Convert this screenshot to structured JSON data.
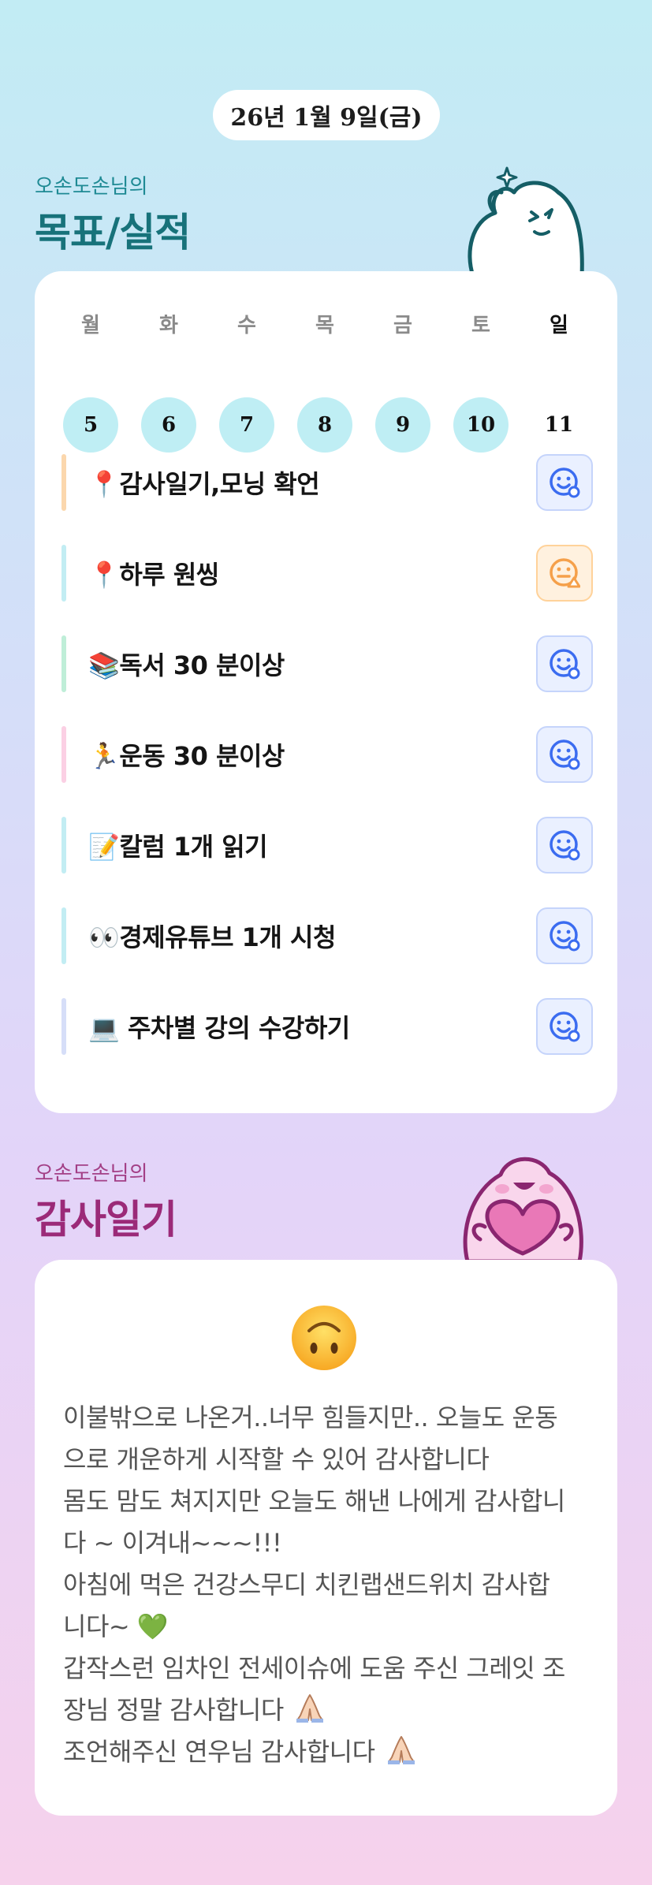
{
  "header": {
    "date": "26년 1월 9일(금)"
  },
  "goal_section": {
    "subtitle": "오손도손님의",
    "title": "목표/실적"
  },
  "week": {
    "days": [
      "월",
      "화",
      "수",
      "목",
      "금",
      "토",
      "일"
    ],
    "dates": [
      "5",
      "6",
      "7",
      "8",
      "9",
      "10",
      "11"
    ],
    "done": [
      true,
      true,
      true,
      true,
      true,
      true,
      false
    ]
  },
  "goals": [
    {
      "label": "📍감사일기,모닝 확언",
      "bar_color": "#fbd7ad",
      "status": "smile",
      "status_icon": "smile-icon"
    },
    {
      "label": "📍하루 원씽",
      "bar_color": "#c2edf3",
      "status": "meh",
      "status_icon": "meh-warning-icon"
    },
    {
      "label": "📚독서 30 분이상",
      "bar_color": "#bfeed8",
      "status": "smile",
      "status_icon": "smile-icon"
    },
    {
      "label": "🏃운동 30 분이상",
      "bar_color": "#fbd0e4",
      "status": "smile",
      "status_icon": "smile-icon"
    },
    {
      "label": "📝칼럼 1개 읽기",
      "bar_color": "#c2edf3",
      "status": "smile",
      "status_icon": "smile-icon"
    },
    {
      "label": "👀경제유튜브 1개 시청",
      "bar_color": "#c2edf3",
      "status": "smile",
      "status_icon": "smile-icon"
    },
    {
      "label": "💻 주차별 강의 수강하기",
      "bar_color": "#d6def8",
      "status": "smile",
      "status_icon": "smile-icon"
    }
  ],
  "diary_section": {
    "subtitle": "오손도손님의",
    "title": "감사일기"
  },
  "diary": {
    "mood_icon": "upside-down-face-icon",
    "lines": [
      "이불밖으로 나온거..너무 힘들지만.. 오늘도 운동",
      "으로 개운하게 시작할 수 있어 감사합니다",
      "몸도 맘도 쳐지지만 오늘도 해낸 나에게 감사합니",
      "다 ~ 이겨내~~~!!!",
      "아침에 먹은 건강스무디 치킨랩샌드위치 감사합",
      "니다~ 💚",
      "갑작스런 임차인 전세이슈에 도움 주신 그레잇 조",
      "장님 정말 감사합니다",
      "조언해주신 연우님 감사합니다"
    ]
  },
  "colors": {
    "accent_teal": "#17727a",
    "accent_magenta": "#9b2a78",
    "done_circle": "#bfeef4",
    "smile_blue": "#3b6cf0",
    "warn_orange": "#f5a04a"
  }
}
